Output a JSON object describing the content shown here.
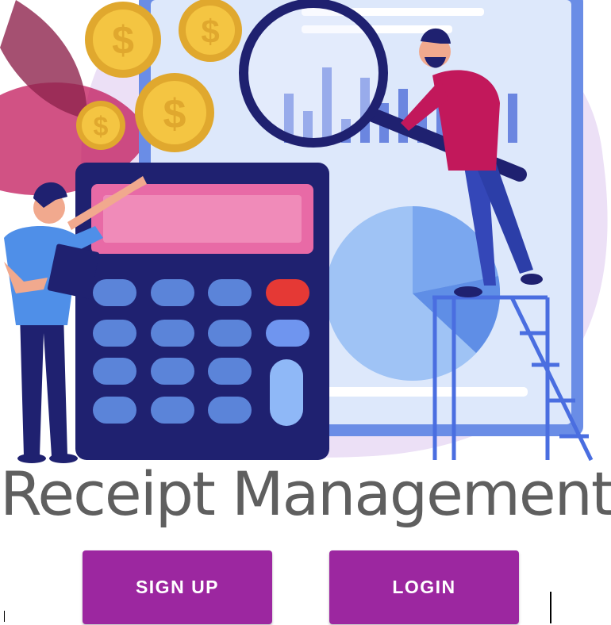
{
  "app": {
    "title": "Receipt Management"
  },
  "hero": {
    "illustration": "financial-analysis-illustration",
    "coin_symbol": "$"
  },
  "actions": {
    "signup_label": "SIGN UP",
    "login_label": "LOGIN"
  },
  "colors": {
    "button_bg": "#9c27a0",
    "button_text": "#ffffff",
    "title_text": "#5f5f5f",
    "calculator_body": "#1f2170",
    "calculator_screen": "#e86aa6",
    "coin": "#f4c542",
    "dashboard_bg": "#dde8fb",
    "blob_bg": "#ece0f6"
  }
}
